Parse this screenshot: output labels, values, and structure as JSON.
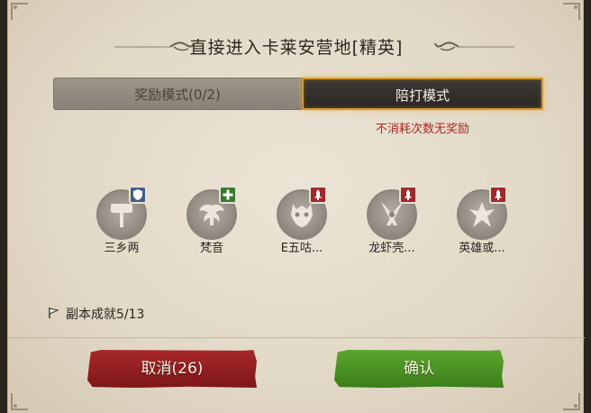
{
  "dialog": {
    "title": "直接进入卡莱安营地[精英]"
  },
  "mode_tabs": {
    "reward_label": "奖励模式(0/2)",
    "escort_label": "陪打模式",
    "escort_selected": true,
    "escort_note": "不消耗次数无奖励"
  },
  "members": [
    {
      "name": "三乡两",
      "role_icon": "shield-icon",
      "role": "tank",
      "emblem": "hammer-icon"
    },
    {
      "name": "梵音",
      "role_icon": "plus-icon",
      "role": "heal",
      "emblem": "wings-icon"
    },
    {
      "name": "E五咕...",
      "role_icon": "sword-icon",
      "role": "dps",
      "emblem": "mask-icon"
    },
    {
      "name": "龙虾壳...",
      "role_icon": "sword-icon",
      "role": "dps",
      "emblem": "crossed-blades-icon"
    },
    {
      "name": "英雄或...",
      "role_icon": "sword-icon",
      "role": "dps",
      "emblem": "claws-icon"
    }
  ],
  "achievement": {
    "icon": "flag-icon",
    "text": "副本成就5/13"
  },
  "buttons": {
    "cancel_label": "取消(26)",
    "confirm_label": "确认"
  },
  "colors": {
    "accent_gold": "#d49a2e",
    "warning_red": "#b3261e",
    "cancel_red": "#a8282a",
    "confirm_green": "#5aa62e",
    "tank_blue": "#3d5f88",
    "heal_green": "#3b7a2e",
    "dps_red": "#a3282b"
  }
}
